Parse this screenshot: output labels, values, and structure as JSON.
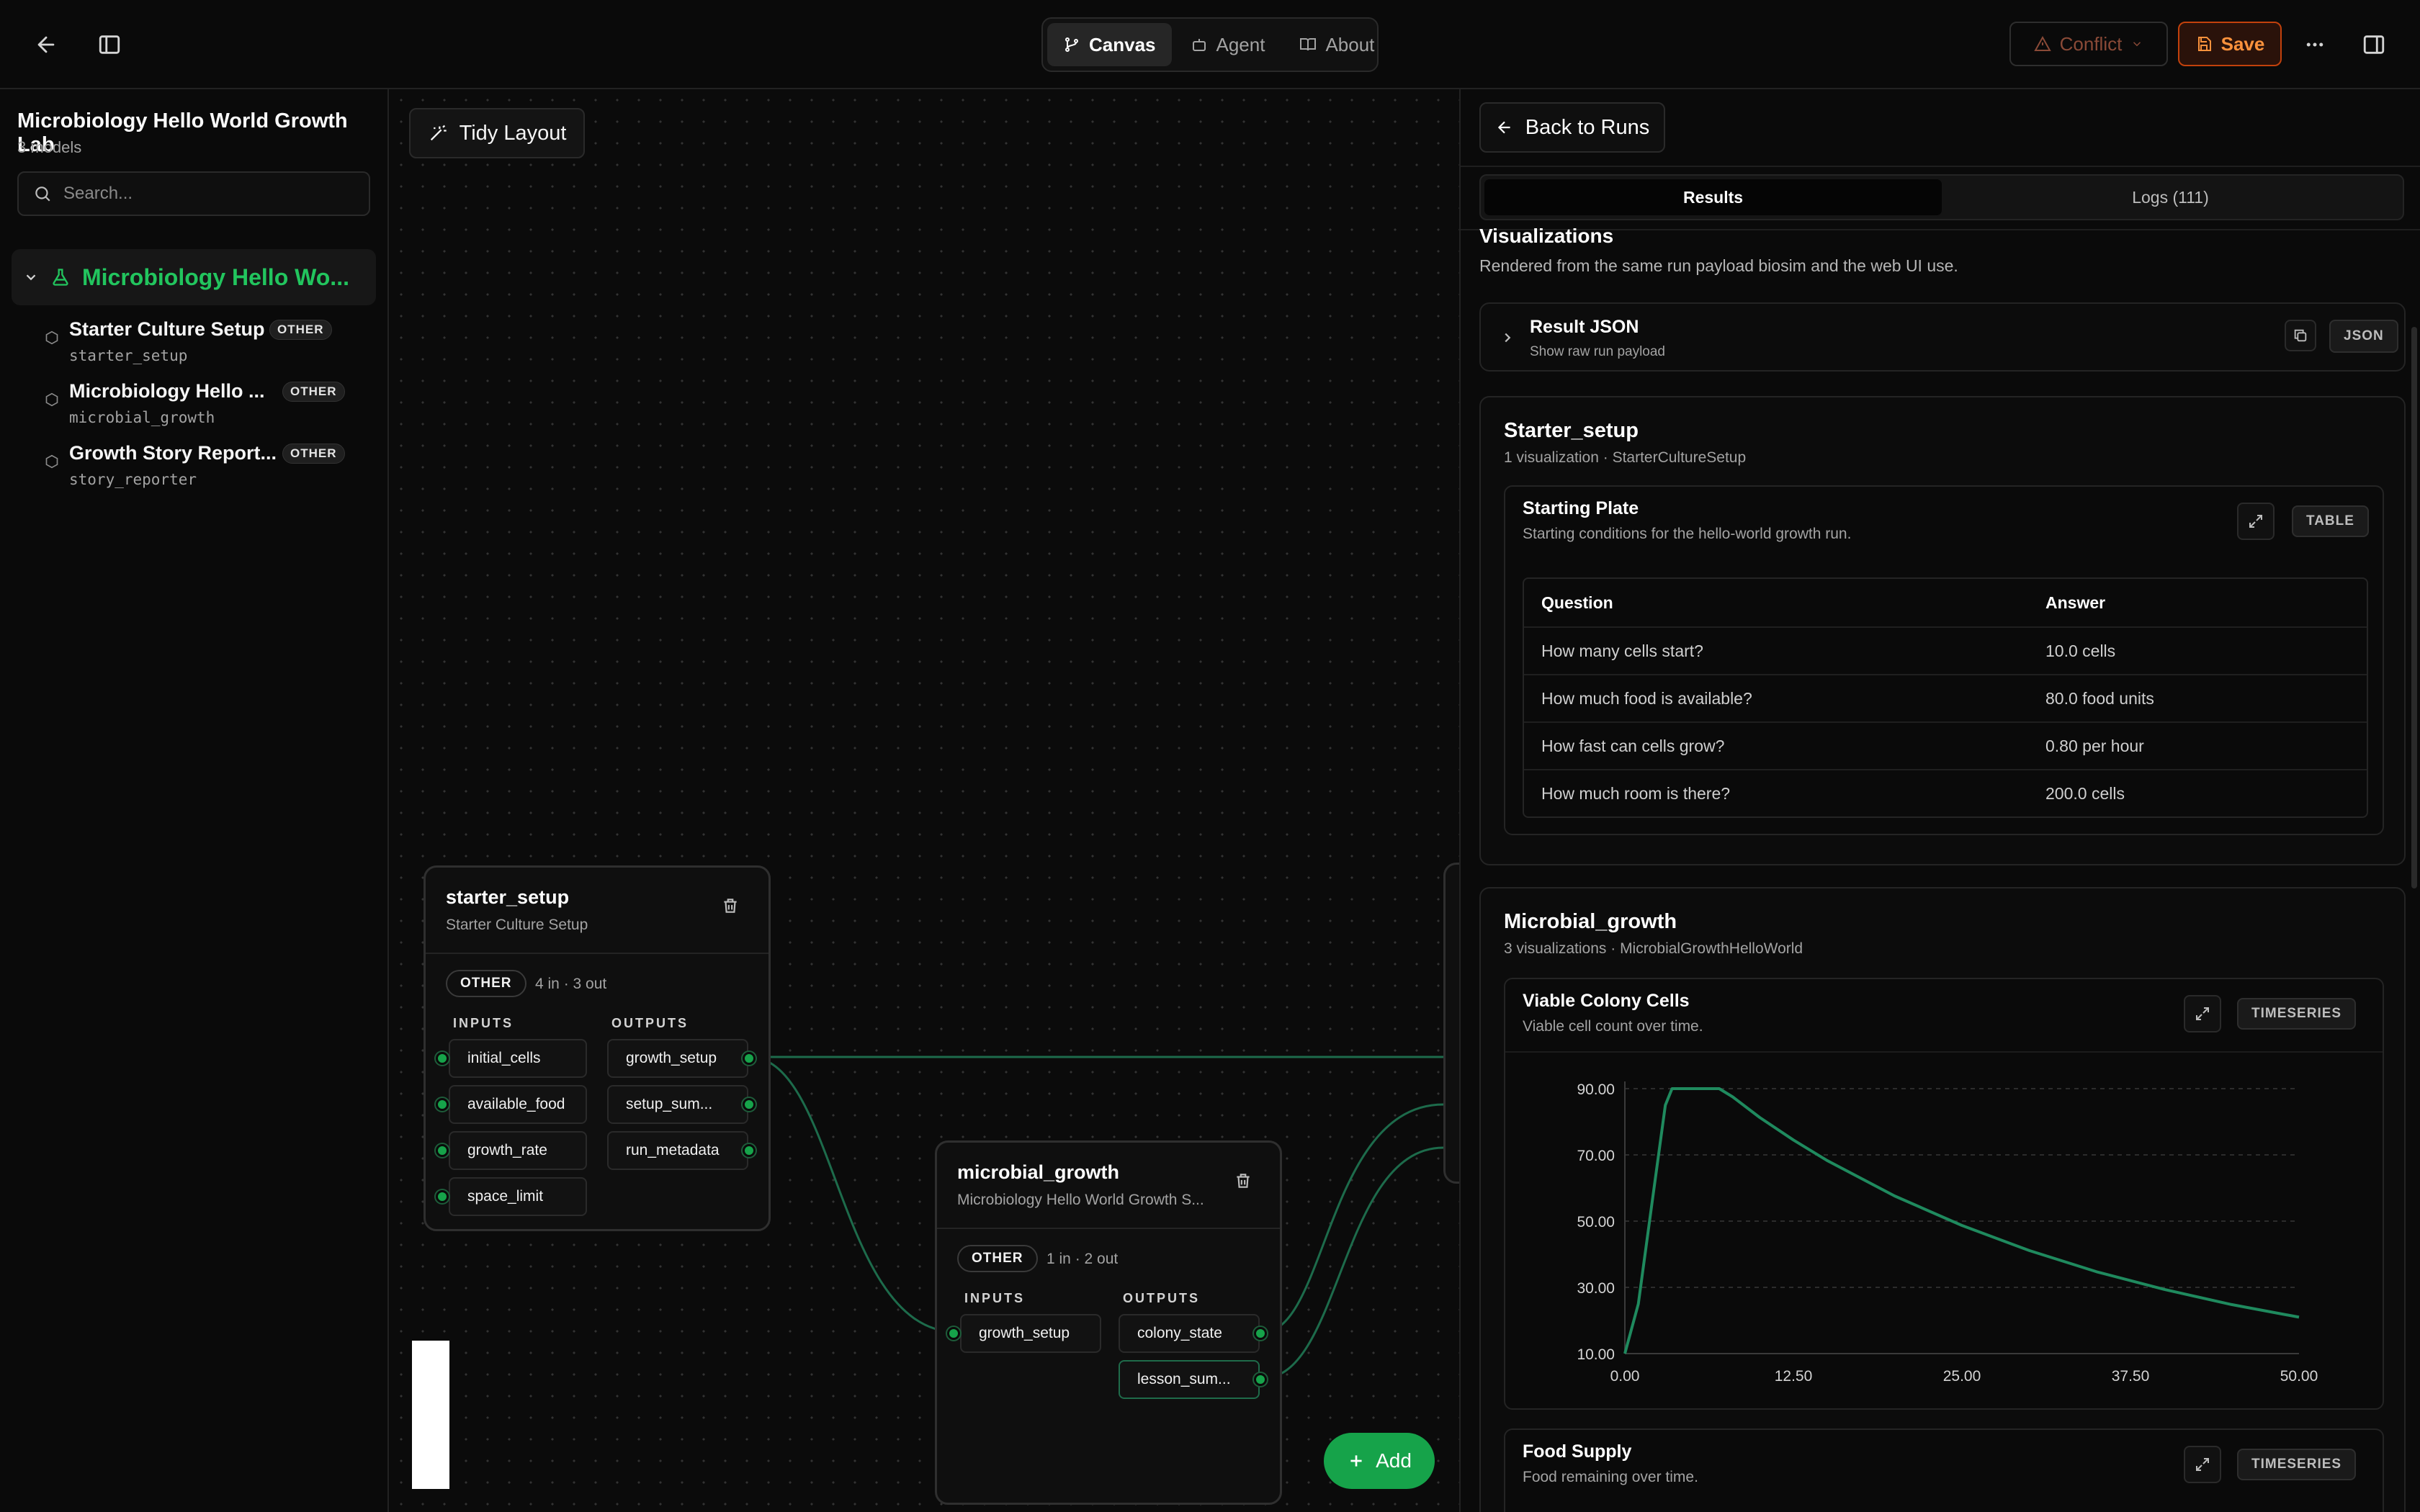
{
  "topbar": {
    "nav": [
      {
        "label": "Canvas",
        "icon": "git-branch-icon",
        "active": true
      },
      {
        "label": "Agent",
        "icon": "bot-icon",
        "active": false
      },
      {
        "label": "About",
        "icon": "book-icon",
        "active": false
      }
    ],
    "conflict_label": "Conflict",
    "save_label": "Save"
  },
  "sidebar": {
    "project_title": "Microbiology Hello World Growth Lab",
    "model_count": "3 models",
    "search_placeholder": "Search...",
    "root_label": "Microbiology Hello Wo...",
    "items": [
      {
        "name": "Starter Culture Setup",
        "badge": "OTHER",
        "slug": "starter_setup"
      },
      {
        "name": "Microbiology Hello ...",
        "badge": "OTHER",
        "slug": "microbial_growth"
      },
      {
        "name": "Growth Story Report...",
        "badge": "OTHER",
        "slug": "story_reporter"
      }
    ]
  },
  "canvas": {
    "tidy_label": "Tidy Layout",
    "add_label": "Add",
    "nodes": [
      {
        "title": "starter_setup",
        "subtitle": "Starter Culture Setup",
        "kind": "OTHER",
        "io": "4 in · 3 out",
        "inputs_label": "INPUTS",
        "outputs_label": "OUTPUTS",
        "inputs": [
          "initial_cells",
          "available_food",
          "growth_rate",
          "space_limit"
        ],
        "outputs": [
          "growth_setup",
          "setup_sum...",
          "run_metadata"
        ]
      },
      {
        "title": "microbial_growth",
        "subtitle": "Microbiology Hello World Growth S...",
        "kind": "OTHER",
        "io": "1 in · 2 out",
        "inputs_label": "INPUTS",
        "outputs_label": "OUTPUTS",
        "inputs": [
          "growth_setup"
        ],
        "outputs": [
          "colony_state",
          "lesson_sum..."
        ]
      }
    ]
  },
  "panel": {
    "back_label": "Back to Runs",
    "tabs": [
      {
        "label": "Results",
        "active": true
      },
      {
        "label": "Logs (111)",
        "active": false
      }
    ],
    "vis_heading": "Visualizations",
    "vis_sub": "Rendered from the same run payload biosim and the web UI use.",
    "result_json": {
      "title": "Result JSON",
      "sub": "Show raw run payload",
      "chip": "JSON"
    },
    "sections": [
      {
        "title": "Starter_setup",
        "sub": "1 visualization · StarterCultureSetup",
        "card": {
          "title": "Starting Plate",
          "sub": "Starting conditions for the hello-world growth run.",
          "chip": "TABLE",
          "columns": [
            "Question",
            "Answer"
          ],
          "rows": [
            [
              "How many cells start?",
              "10.0 cells"
            ],
            [
              "How much food is available?",
              "80.0 food units"
            ],
            [
              "How fast can cells grow?",
              "0.80 per hour"
            ],
            [
              "How much room is there?",
              "200.0 cells"
            ]
          ]
        }
      },
      {
        "title": "Microbial_growth",
        "sub": "3 visualizations · MicrobialGrowthHelloWorld",
        "cards": [
          {
            "title": "Viable Colony Cells",
            "sub": "Viable cell count over time.",
            "chip": "TIMESERIES"
          },
          {
            "title": "Food Supply",
            "sub": "Food remaining over time.",
            "chip": "TIMESERIES"
          }
        ]
      }
    ]
  },
  "chart_data": {
    "type": "line",
    "title": "Viable Colony Cells",
    "xlabel": "",
    "ylabel": "",
    "xlim": [
      0,
      50
    ],
    "ylim": [
      10,
      90
    ],
    "x_ticks": [
      "0.00",
      "12.50",
      "25.00",
      "37.50",
      "50.00"
    ],
    "y_ticks": [
      "10.00",
      "30.00",
      "50.00",
      "70.00",
      "90.00"
    ],
    "grid": "horizontal dashed",
    "color": "#1f8a5e",
    "series": [
      {
        "x": [
          0,
          1,
          2,
          3,
          3.5,
          4,
          7,
          8,
          10,
          12.5,
          15,
          20,
          25,
          30,
          35,
          40,
          45,
          50
        ],
        "values": [
          10,
          25,
          55,
          85,
          90,
          90,
          90,
          87.5,
          81.3,
          74.5,
          68.3,
          57.6,
          48.7,
          41.1,
          34.7,
          29.4,
          24.8,
          21
        ]
      }
    ]
  }
}
